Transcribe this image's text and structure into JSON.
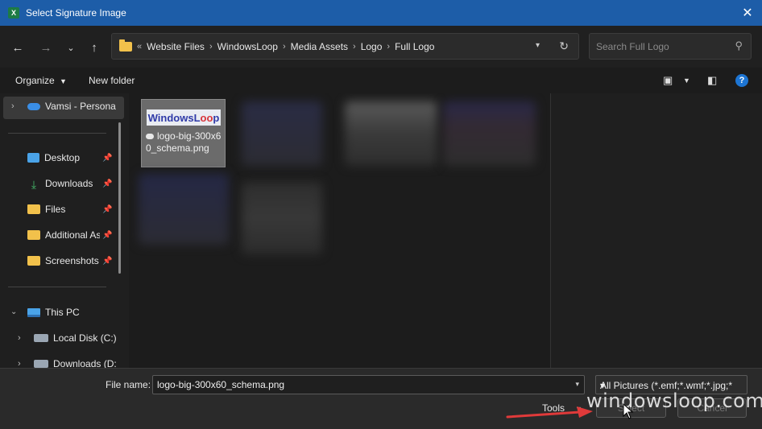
{
  "window": {
    "title": "Select Signature Image",
    "app_icon": "X",
    "close_icon": "close-icon"
  },
  "nav": {
    "breadcrumb_prefix": "«",
    "breadcrumbs": [
      "Website Files",
      "WindowsLoop",
      "Media Assets",
      "Logo",
      "Full Logo"
    ],
    "search_placeholder": "Search Full Logo"
  },
  "toolbar": {
    "organize_label": "Organize",
    "new_folder_label": "New folder",
    "help_label": "?"
  },
  "sidebar": {
    "items": [
      {
        "label": "Vamsi - Persona",
        "icon": "onedrive-cloud-icon"
      },
      {
        "label": "Desktop",
        "icon": "desktop-icon",
        "pinned": true
      },
      {
        "label": "Downloads",
        "icon": "download-icon",
        "pinned": true
      },
      {
        "label": "Files",
        "icon": "folder-icon",
        "pinned": true
      },
      {
        "label": "Additional As",
        "icon": "folder-icon",
        "pinned": true
      },
      {
        "label": "Screenshots",
        "icon": "folder-icon",
        "pinned": true
      },
      {
        "label": "This PC",
        "icon": "pc-icon"
      },
      {
        "label": "Local Disk (C:)",
        "icon": "disk-icon"
      },
      {
        "label": "Downloads (D:",
        "icon": "disk-icon"
      }
    ]
  },
  "content": {
    "selected_file": {
      "thumbnail_text_a": "WindowsL",
      "thumbnail_text_b": "oo",
      "thumbnail_text_c": "p",
      "name": "logo-big-300x60_schema.png"
    }
  },
  "bottom": {
    "file_name_label": "File name:",
    "file_name_value": "logo-big-300x60_schema.png",
    "file_type_value": "All Pictures (*.emf;*.wmf;*.jpg;*",
    "tools_label": "Tools",
    "select_label": "Select",
    "cancel_label": "Cancel"
  },
  "watermark": "windowsloop.com",
  "colors": {
    "titlebar": "#1d5da8",
    "arrow": "#e03a3a",
    "accent": "#1d75d3"
  }
}
